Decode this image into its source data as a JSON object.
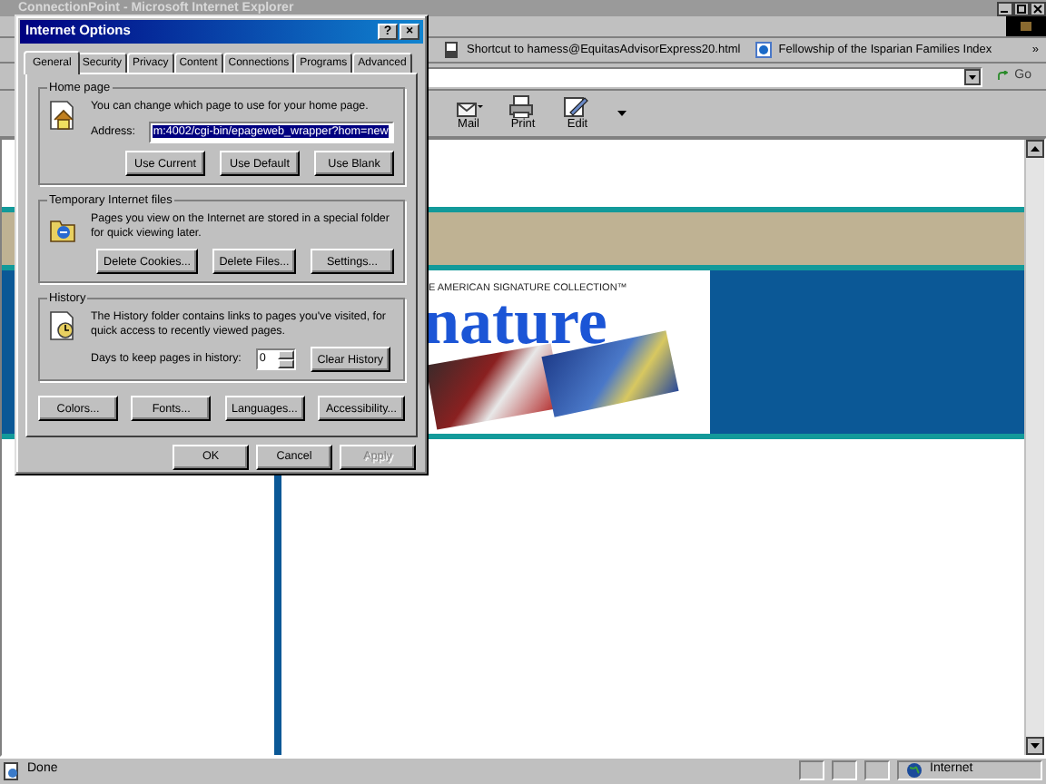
{
  "browser": {
    "title": "ConnectionPoint - Microsoft Internet Explorer",
    "links": [
      {
        "label": "Shortcut to hamess@EquitasAdvisorExpress20.html"
      },
      {
        "label": "Fellowship of the Isparian Families  Index"
      }
    ],
    "links_more": "»",
    "go": "Go",
    "toolbar": [
      {
        "kind": "mail",
        "label": "Mail"
      },
      {
        "kind": "print",
        "label": "Print"
      },
      {
        "kind": "edit",
        "label": "Edit"
      }
    ],
    "status": "Done",
    "zone": "Internet"
  },
  "page": {
    "banner_caption": "E AMERICAN SIGNATURE COLLECTION™",
    "banner_title": "nature"
  },
  "dialog": {
    "title": "Internet Options",
    "help": "?",
    "close": "×",
    "tabs": [
      {
        "label": "General",
        "selected": true
      },
      {
        "label": "Security",
        "selected": false
      },
      {
        "label": "Privacy",
        "selected": false
      },
      {
        "label": "Content",
        "selected": false
      },
      {
        "label": "Connections",
        "selected": false
      },
      {
        "label": "Programs",
        "selected": false
      },
      {
        "label": "Advanced",
        "selected": false
      }
    ],
    "home": {
      "title": "Home page",
      "text": "You can change which page to use for your home page.",
      "address_label": "Address:",
      "address": "m:4002/cgi-bin/epageweb_wrapper?hom=new",
      "address_selected": true,
      "buttons": [
        {
          "label": "Use Current",
          "disabled": false
        },
        {
          "label": "Use Default",
          "disabled": false
        },
        {
          "label": "Use Blank",
          "disabled": false
        }
      ]
    },
    "temp": {
      "title": "Temporary Internet files",
      "text": "Pages you view on the Internet are stored in a special folder for quick viewing later.",
      "buttons": [
        {
          "label": "Delete Cookies...",
          "disabled": false
        },
        {
          "label": "Delete Files...",
          "disabled": false
        },
        {
          "label": "Settings...",
          "disabled": false
        }
      ]
    },
    "history": {
      "title": "History",
      "text": "The History folder contains links to pages you've visited, for quick access to recently viewed pages.",
      "days_label": "Days to keep pages in history:",
      "days": "0",
      "buttons": [
        {
          "label": "Clear History",
          "disabled": false
        }
      ]
    },
    "bottom_buttons": [
      {
        "label": "Colors...",
        "disabled": false
      },
      {
        "label": "Fonts...",
        "disabled": false
      },
      {
        "label": "Languages...",
        "disabled": false
      },
      {
        "label": "Accessibility...",
        "disabled": false
      }
    ],
    "footer_buttons": [
      {
        "label": "OK",
        "disabled": false
      },
      {
        "label": "Cancel",
        "disabled": false
      },
      {
        "label": "Apply",
        "disabled": true
      }
    ]
  }
}
